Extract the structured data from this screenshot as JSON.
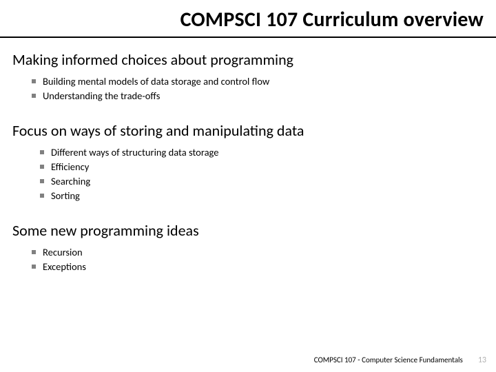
{
  "title": "COMPSCI 107 Curriculum overview",
  "sections": [
    {
      "heading": "Making informed choices about programming",
      "indent": 1,
      "items": [
        "Building mental models of data storage and control flow",
        "Understanding the trade-offs"
      ]
    },
    {
      "heading": "Focus on ways of storing and manipulating data",
      "indent": 2,
      "items": [
        "Different ways of structuring data storage",
        "Efficiency",
        "Searching",
        "Sorting"
      ]
    },
    {
      "heading": "Some new programming ideas",
      "indent": 1,
      "items": [
        "Recursion",
        "Exceptions"
      ]
    }
  ],
  "footer": {
    "text": "COMPSCI 107 - Computer Science Fundamentals",
    "page": "13"
  }
}
